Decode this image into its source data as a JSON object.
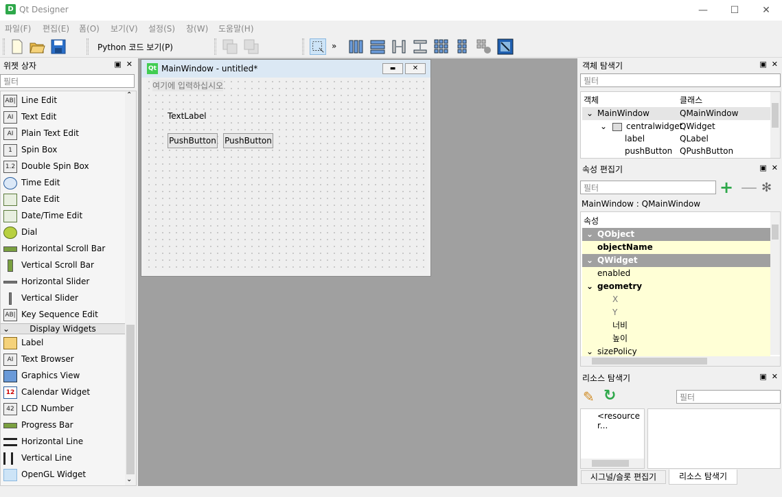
{
  "window": {
    "title": "Qt Designer",
    "icon": "D"
  },
  "menu": [
    "파일(F)",
    "편집(E)",
    "폼(O)",
    "보기(V)",
    "설정(S)",
    "창(W)",
    "도움말(H)"
  ],
  "toolbar": {
    "python_label": "Python 코드 보기(P)"
  },
  "widget_box": {
    "title": "위젯 상자",
    "filter_placeholder": "필터",
    "items": [
      "Line Edit",
      "Text Edit",
      "Plain Text Edit",
      "Spin Box",
      "Double Spin Box",
      "Time Edit",
      "Date Edit",
      "Date/Time Edit",
      "Dial",
      "Horizontal Scroll Bar",
      "Vertical Scroll Bar",
      "Horizontal Slider",
      "Vertical Slider",
      "Key Sequence Edit"
    ],
    "category": "Display Widgets",
    "display_items": [
      "Label",
      "Text Browser",
      "Graphics View",
      "Calendar Widget",
      "LCD Number",
      "Progress Bar",
      "Horizontal Line",
      "Vertical Line",
      "OpenGL Widget"
    ]
  },
  "form": {
    "title": "MainWindow - untitled*",
    "menu_placeholder": "여기에 입력하십시오",
    "label": "TextLabel",
    "button1": "PushButton",
    "button2": "PushButton"
  },
  "object_inspector": {
    "title": "객체 탐색기",
    "filter": "필터",
    "col_object": "객체",
    "col_class": "클래스",
    "rows": [
      {
        "obj": "MainWindow",
        "cls": "QMainWindow"
      },
      {
        "obj": "centralwidget",
        "cls": "QWidget"
      },
      {
        "obj": "label",
        "cls": "QLabel"
      },
      {
        "obj": "pushButton",
        "cls": "QPushButton"
      }
    ]
  },
  "property_editor": {
    "title": "속성 편집기",
    "filter": "필터",
    "context": "MainWindow : QMainWindow",
    "header": "속성",
    "rows": [
      "QObject",
      "objectName",
      "QWidget",
      "enabled",
      "geometry",
      "X",
      "Y",
      "너비",
      "높이",
      "sizePolicy"
    ]
  },
  "resource_browser": {
    "title": "리소스 탐색기",
    "filter": "필터",
    "root": "<resource r..."
  },
  "bottom_tabs": [
    "시그널/슬롯 편집기",
    "리소스 탐색기"
  ],
  "colors": {
    "section_bg": "#a0a0a0",
    "yellow": "#ffffd6",
    "accent": "#2ea84a"
  }
}
